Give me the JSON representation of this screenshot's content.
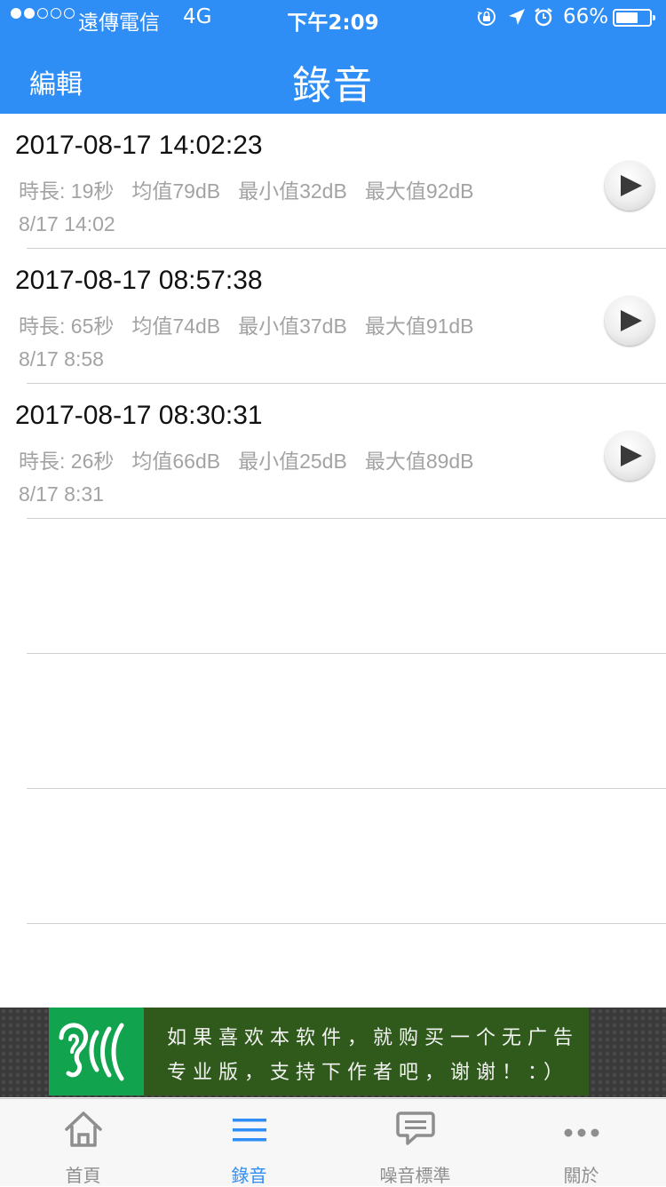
{
  "status_bar": {
    "signal_bars_filled": 2,
    "signal_bars_total": 5,
    "carrier": "遠傳電信",
    "network": "4G",
    "time": "下午2:09",
    "battery_percent": "66%",
    "battery_level": 0.66,
    "icons": [
      "rotation-lock-icon",
      "location-arrow-icon",
      "alarm-icon"
    ]
  },
  "nav": {
    "edit_label": "編輯",
    "title": "錄音"
  },
  "recordings": [
    {
      "title": "2017-08-17 14:02:23",
      "duration": "時長: 19秒",
      "avg": "均值79dB",
      "min": "最小值32dB",
      "max": "最大值92dB",
      "date": "8/17 14:02"
    },
    {
      "title": "2017-08-17 08:57:38",
      "duration": "時長: 65秒",
      "avg": "均值74dB",
      "min": "最小值37dB",
      "max": "最大值91dB",
      "date": "8/17 8:58"
    },
    {
      "title": "2017-08-17 08:30:31",
      "duration": "時長: 26秒",
      "avg": "均值66dB",
      "min": "最小值25dB",
      "max": "最大值89dB",
      "date": "8/17 8:31"
    }
  ],
  "ad": {
    "line1": "如果喜欢本软件，就购买一个无广告",
    "line2": "专业版，支持下作者吧，谢谢！：）"
  },
  "tabs": [
    {
      "label": "首頁",
      "icon": "home-icon"
    },
    {
      "label": "錄音",
      "icon": "list-icon"
    },
    {
      "label": "噪音標準",
      "icon": "chat-bubble-icon"
    },
    {
      "label": "關於",
      "icon": "more-dots-icon"
    }
  ],
  "colors": {
    "accent": "#2e8ef5",
    "secondary_text": "#a3a3a3",
    "ad_green": "#11a34d"
  }
}
